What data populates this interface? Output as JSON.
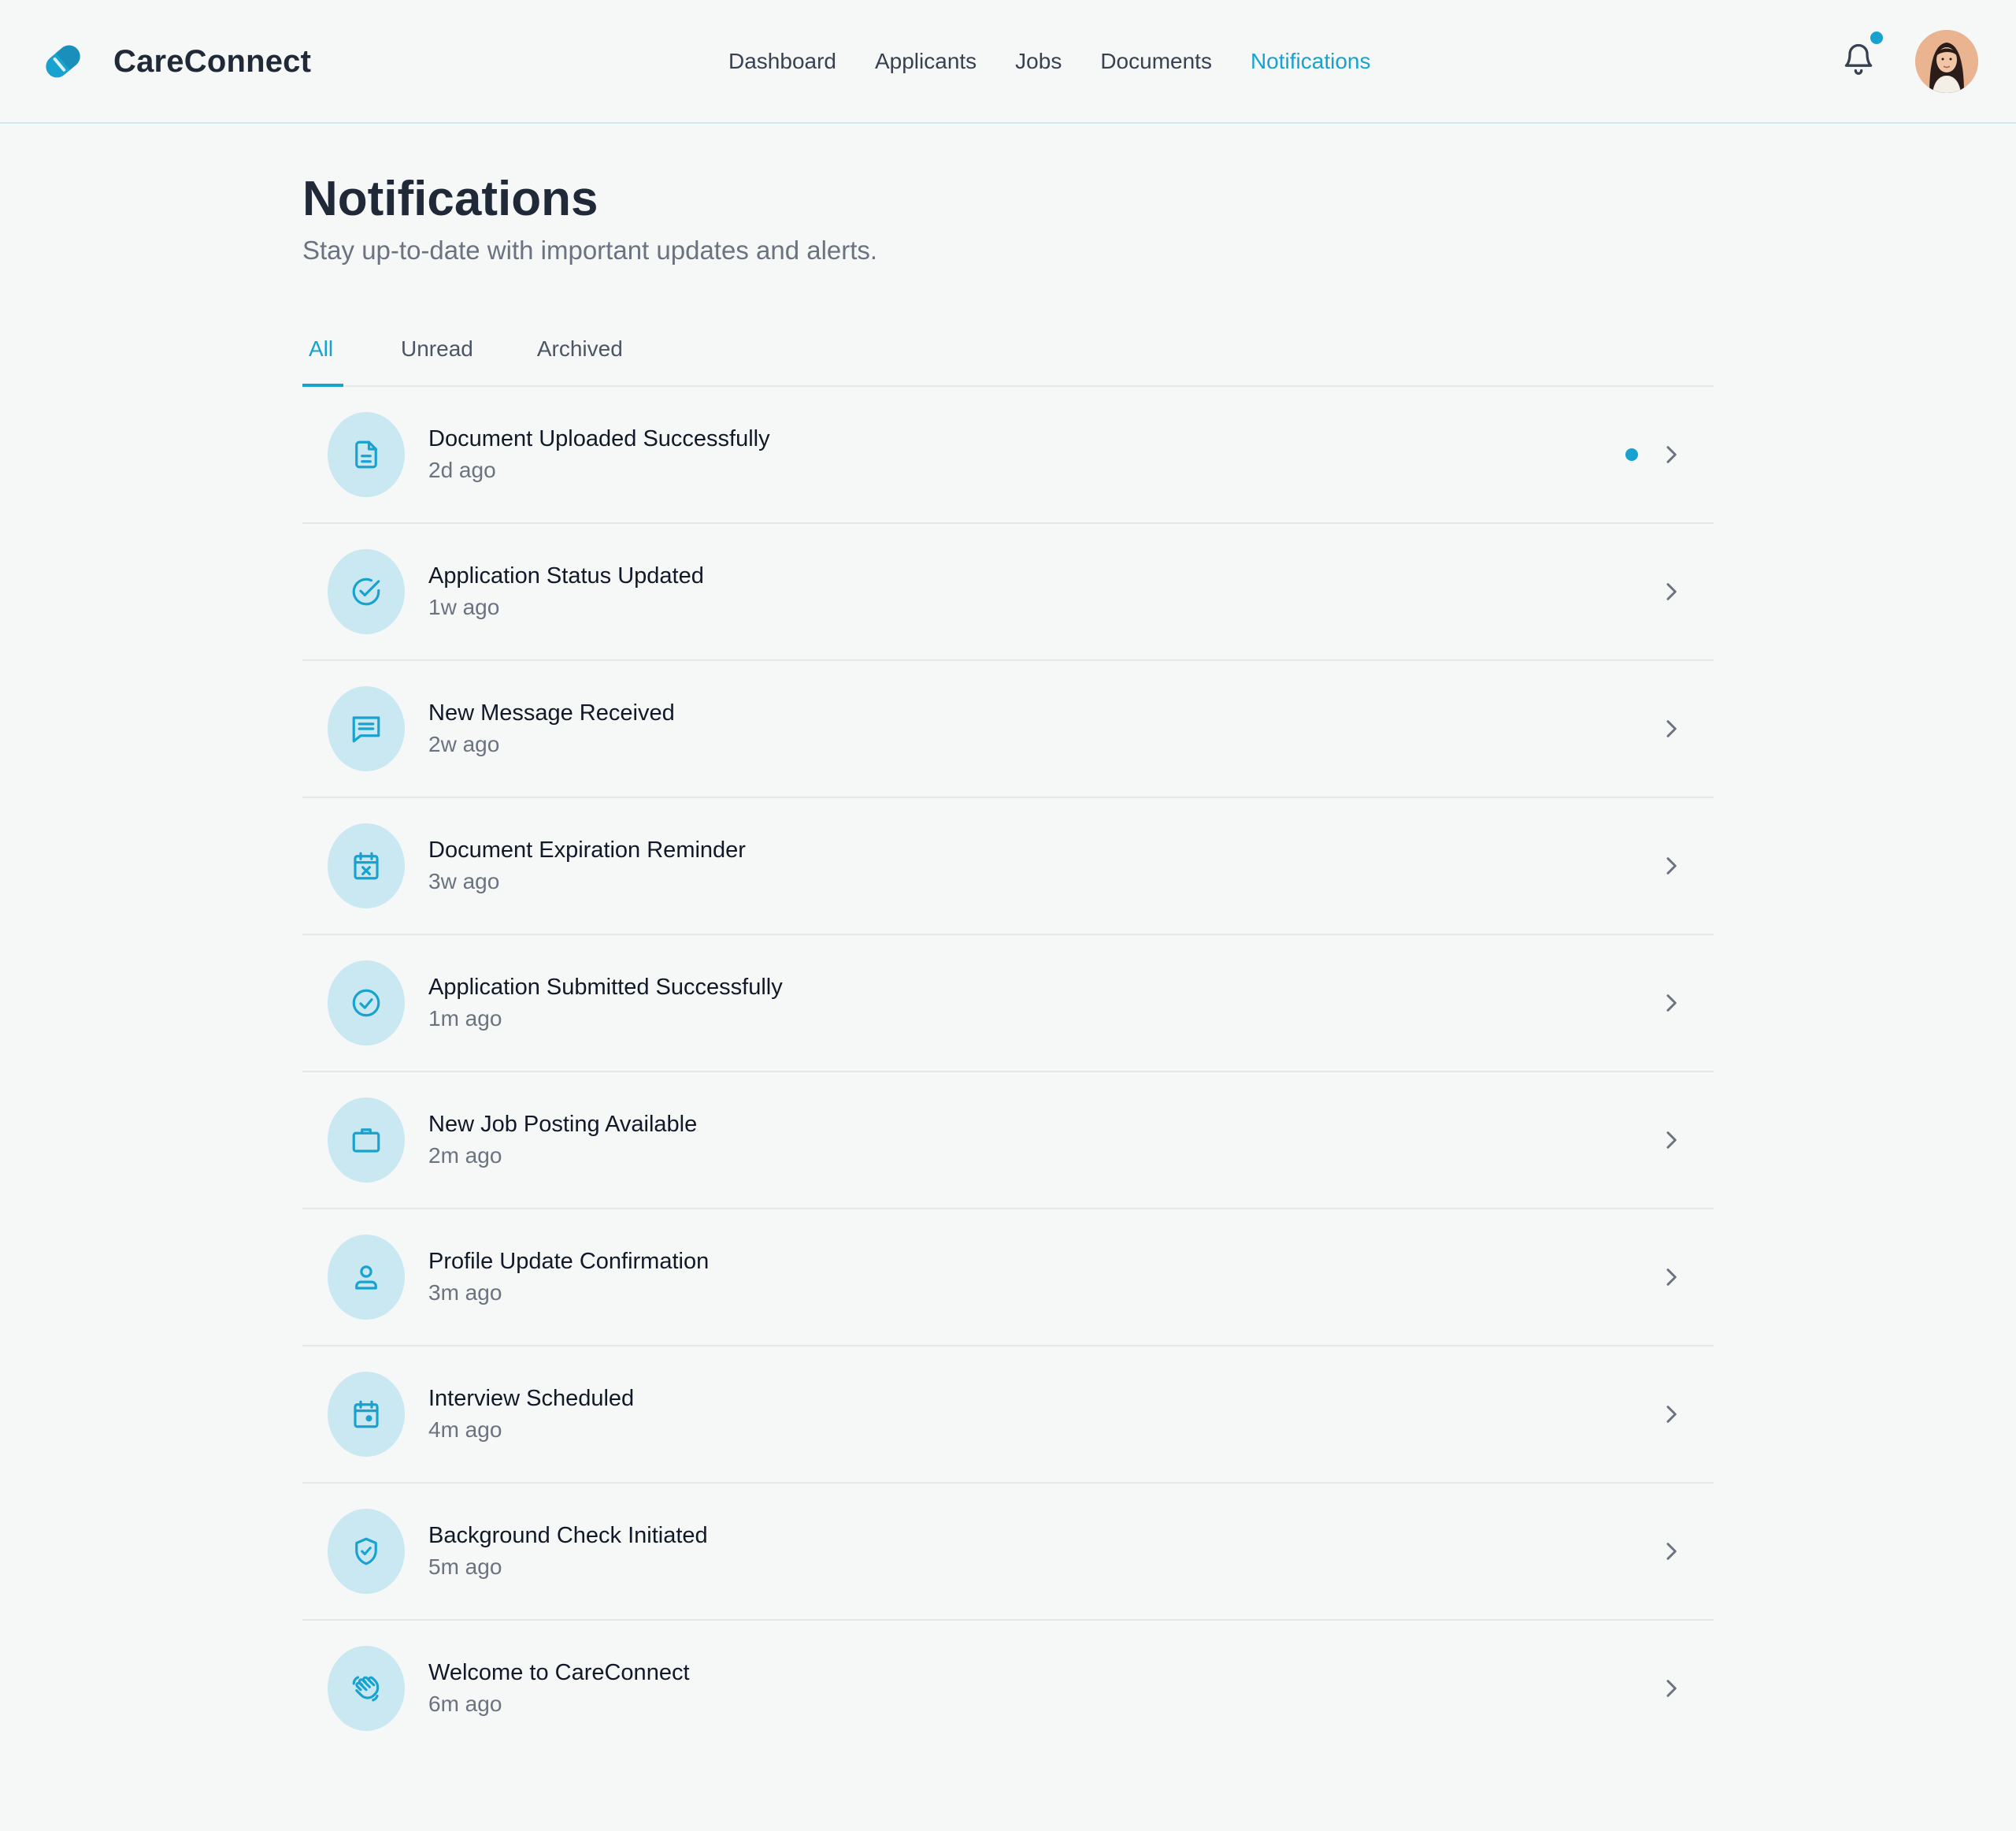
{
  "app": {
    "name": "CareConnect",
    "logo_icon": "brand-logo-icon"
  },
  "nav": {
    "items": [
      {
        "label": "Dashboard",
        "active": false
      },
      {
        "label": "Applicants",
        "active": false
      },
      {
        "label": "Jobs",
        "active": false
      },
      {
        "label": "Documents",
        "active": false
      },
      {
        "label": "Notifications",
        "active": true
      }
    ]
  },
  "header": {
    "bell_icon": "bell-icon",
    "has_unread_indicator": true,
    "avatar_icon": "user-avatar"
  },
  "page": {
    "title": "Notifications",
    "subtitle": "Stay up-to-date with important updates and alerts."
  },
  "tabs": [
    {
      "label": "All",
      "active": true
    },
    {
      "label": "Unread",
      "active": false
    },
    {
      "label": "Archived",
      "active": false
    }
  ],
  "notifications": [
    {
      "title": "Document Uploaded Successfully",
      "time": "2d ago",
      "icon": "document-icon",
      "unread": true
    },
    {
      "title": "Application Status Updated",
      "time": "1w ago",
      "icon": "check-circle-icon",
      "unread": false
    },
    {
      "title": "New Message Received",
      "time": "2w ago",
      "icon": "message-icon",
      "unread": false
    },
    {
      "title": "Document Expiration Reminder",
      "time": "3w ago",
      "icon": "calendar-x-icon",
      "unread": false
    },
    {
      "title": "Application Submitted Successfully",
      "time": "1m ago",
      "icon": "check-circle-icon",
      "unread": false
    },
    {
      "title": "New Job Posting Available",
      "time": "2m ago",
      "icon": "briefcase-icon",
      "unread": false
    },
    {
      "title": "Profile Update Confirmation",
      "time": "3m ago",
      "icon": "user-icon",
      "unread": false
    },
    {
      "title": "Interview Scheduled",
      "time": "4m ago",
      "icon": "calendar-icon",
      "unread": false
    },
    {
      "title": "Background Check Initiated",
      "time": "5m ago",
      "icon": "shield-check-icon",
      "unread": false
    },
    {
      "title": "Welcome to CareConnect",
      "time": "6m ago",
      "icon": "wave-hand-icon",
      "unread": false
    }
  ],
  "colors": {
    "accent": "#17a2cf",
    "icon_bg": "#c9e8f1",
    "background": "#f6f8f8",
    "divider": "#e5e9eb"
  }
}
